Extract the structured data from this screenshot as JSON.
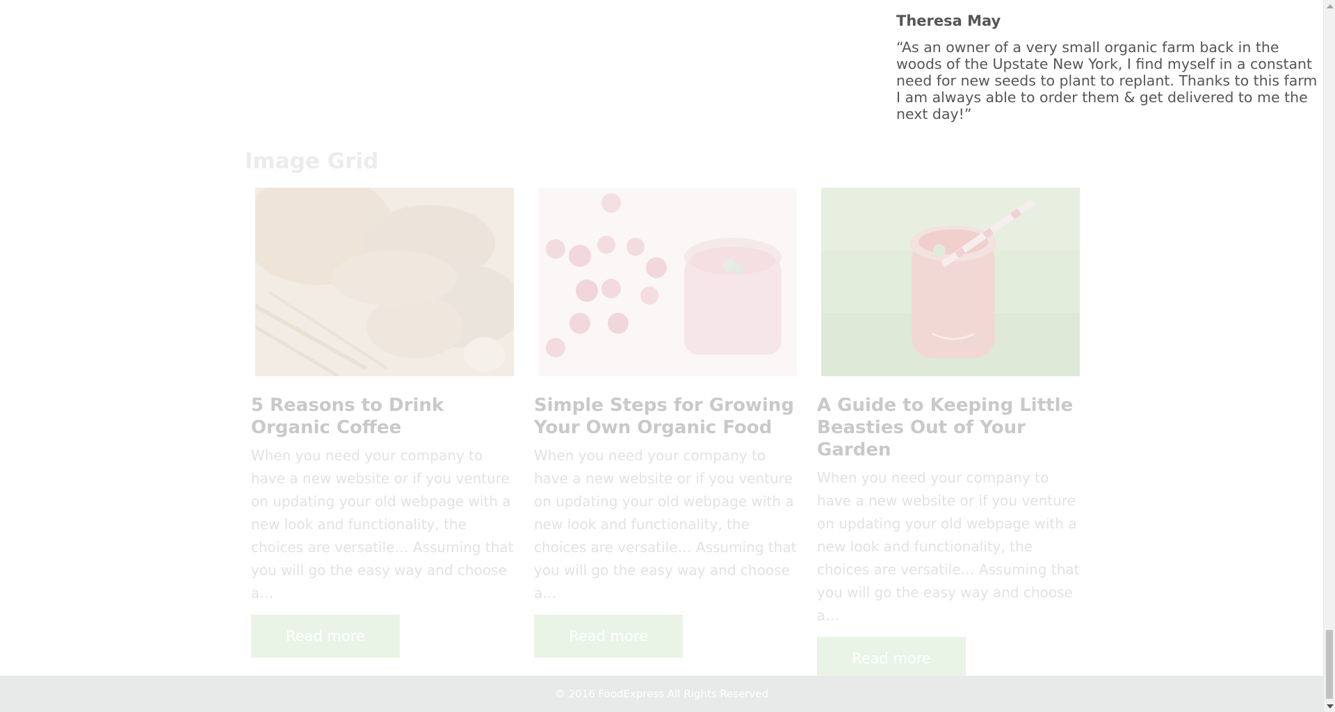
{
  "testimonial": {
    "name": "Theresa May",
    "quote": "“As an owner of a very small organic farm back in the woods of the Upstate New York, I find myself in a constant need for new seeds to plant to replant. Thanks to this farm I am always able to order them & get delivered to me the next day!”"
  },
  "image_grid": {
    "title": "Image Grid",
    "cards": [
      {
        "image": "bread-slices-and-wheat",
        "title": "5 Reasons to Drink Organic Coffee",
        "text": "When you need your company to have a new website or if you venture on updating your old webpage with a new look and functionality, the choices are versatile… Assuming that you will go the easy way and choose a…",
        "button": "Read more"
      },
      {
        "image": "raspberry-smoothie-glass",
        "title": "Simple Steps for Growing Your Own Organic Food",
        "text": "When you need your company to have a new website or if you venture on updating your old webpage with a new look and functionality, the choices are versatile… Assuming that you will go the easy way and choose a…",
        "button": "Read more"
      },
      {
        "image": "strawberry-drink-jar-on-grass",
        "title": "A Guide to Keeping Little Beasties Out of Your Garden",
        "text": "When you need your company to have a new website or if you venture on updating your old webpage with a new look and functionality, the choices are versatile… Assuming that you will go the easy way and choose a…",
        "button": "Read more"
      }
    ]
  },
  "footer": {
    "text": "© 2016 FoodExpress All Rights Reserved"
  },
  "colors": {
    "button_bg": "#eaf4e6",
    "footer_bg": "#e8e9e9",
    "text_dark": "#555555"
  }
}
